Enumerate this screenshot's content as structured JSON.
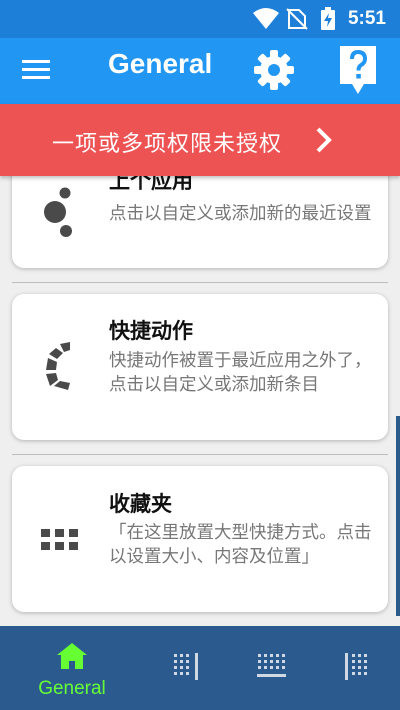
{
  "status_bar": {
    "time": "5:51",
    "icons": [
      "wifi-icon",
      "no-sim-icon",
      "battery-charging-icon"
    ]
  },
  "app_bar": {
    "title": "General",
    "icons": [
      "menu-icon",
      "gear-icon",
      "help-icon"
    ]
  },
  "banner": {
    "text": "一项或多项权限未授权",
    "color": "#ee5354"
  },
  "cards": [
    {
      "title": "上个应用",
      "description": "点击以自定义或添加新的最近设置",
      "icon": "recent-apps-icon"
    },
    {
      "title": "快捷动作",
      "description": "快捷动作被置于最近应用之外了，点击以自定义或添加新条目",
      "icon": "quick-actions-icon"
    },
    {
      "title": "收藏夹",
      "description": "「在这里放置大型快捷方式。点击以设置大小、内容及位置」",
      "icon": "grid-icon"
    }
  ],
  "bottom_nav": {
    "items": [
      {
        "label": "General",
        "icon": "home-icon",
        "active": true
      },
      {
        "label": "",
        "icon": "grid-layout-icon-1",
        "active": false
      },
      {
        "label": "",
        "icon": "grid-layout-icon-2",
        "active": false
      },
      {
        "label": "",
        "icon": "grid-layout-icon-3",
        "active": false
      }
    ]
  },
  "colors": {
    "status_bar": "#1e7fd8",
    "app_bar": "#2196f3",
    "bottom_nav": "#2b5a8f",
    "active_nav": "#66ff33"
  }
}
